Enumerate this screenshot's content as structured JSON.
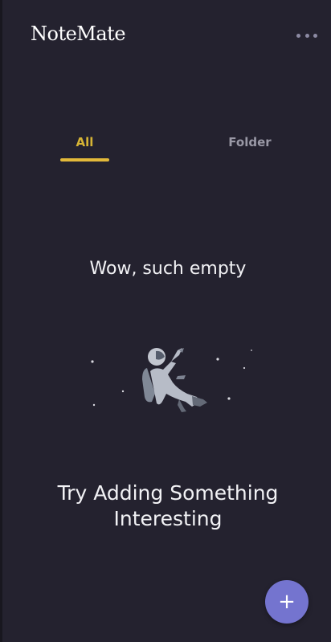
{
  "app": {
    "title": "NoteMate",
    "menu_icon": "more-horizontal-icon"
  },
  "tabs": [
    {
      "label": "All",
      "active": true
    },
    {
      "label": "Folder",
      "active": false
    }
  ],
  "empty_state": {
    "message": "Wow, such empty",
    "illustration": "astronaut-floating-in-space",
    "cta": "Try Adding Something Interesting"
  },
  "fab": {
    "label": "+",
    "icon": "plus-icon"
  },
  "colors": {
    "background": "#24222f",
    "accent_tab": "#d6b435",
    "fab": "#7474cf",
    "text": "#f2f2f5"
  }
}
